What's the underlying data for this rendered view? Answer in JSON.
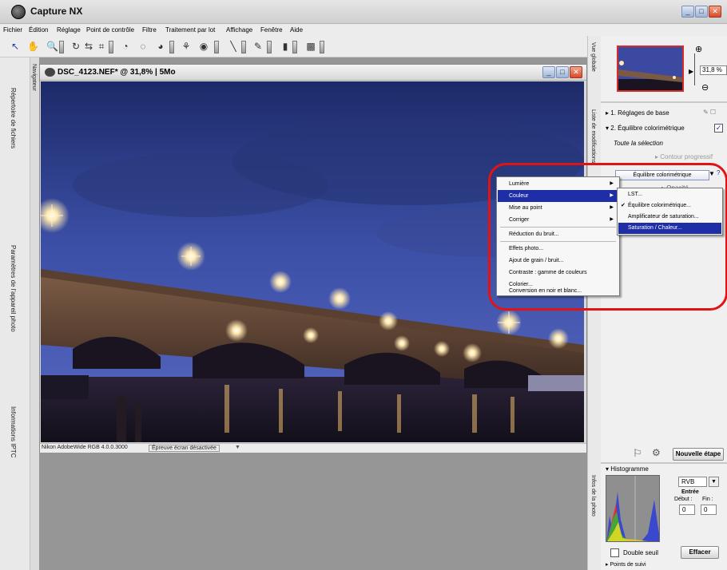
{
  "app": {
    "title": "Capture NX"
  },
  "menubar": [
    "Fichier",
    "Édition",
    "Réglage",
    "Point de contrôle",
    "Filtre",
    "Traitement par lot",
    "Affichage",
    "Fenêtre",
    "Aide"
  ],
  "toolbar_icons": [
    "select-arrow-icon",
    "hand-icon",
    "zoom-icon",
    "rotate-icon",
    "straighten-icon",
    "crop-icon",
    "black-point-icon",
    "white-point-icon",
    "neutral-point-icon",
    "color-control-point-icon",
    "red-eye-icon",
    "lasso-icon",
    "brush-icon",
    "gradient-icon",
    "fill-icon"
  ],
  "left_tabs": {
    "browser": "Répertoire de fichiers",
    "camera": "Paramètres de l'appareil photo",
    "iptc": "Informations IPTC",
    "navigator": "Navigateur"
  },
  "document": {
    "title": "DSC_4123.NEF* @ 31,8% | 5Mo",
    "status_profile": "Nikon AdobeWide RGB 4.0.0.3000",
    "status_proof": "Épreuve écran désactivée"
  },
  "right_tabs": {
    "overview": "Vue globale",
    "edit_list": "Liste de modifications",
    "photo_info": "Infos de la photo"
  },
  "zoom": {
    "value": "31,8 %"
  },
  "edit_list": {
    "step1": "1. Réglages de base",
    "step2": "2. Équilibre colorimétrique",
    "selection": "Toute la sélection",
    "progressive": "Contour progressif",
    "selected_filter": "Équilibre colorimétrique",
    "opacity": "Opacité",
    "new_step": "Nouvelle étape"
  },
  "context_menu": {
    "items": [
      "Lumière",
      "Couleur",
      "Mise au point",
      "Corriger",
      "Réduction du bruit...",
      "Effets photo...",
      "Ajout de grain / bruit...",
      "Contraste : gamme de couleurs",
      "Colorier...",
      "Conversion en noir et blanc..."
    ],
    "highlighted": "Couleur"
  },
  "submenu": {
    "items": [
      "LST...",
      "Équilibre colorimétrique...",
      "Amplificateur de saturation...",
      "Saturation / Chaleur..."
    ],
    "checked": "Équilibre colorimétrique...",
    "highlighted": "Saturation / Chaleur..."
  },
  "histogram": {
    "title": "Histogramme",
    "channel": "RVB",
    "entry_label": "Entrée",
    "start_label": "Début :",
    "end_label": "Fin :",
    "start_value": "0",
    "end_value": "0",
    "double_threshold": "Double seuil",
    "clear": "Effacer",
    "tracking": "Points de suivi"
  },
  "colors": {
    "highlight": "#1e2ea6",
    "annotation_ring": "#e01414",
    "thumb_border": "#d42b2b"
  }
}
